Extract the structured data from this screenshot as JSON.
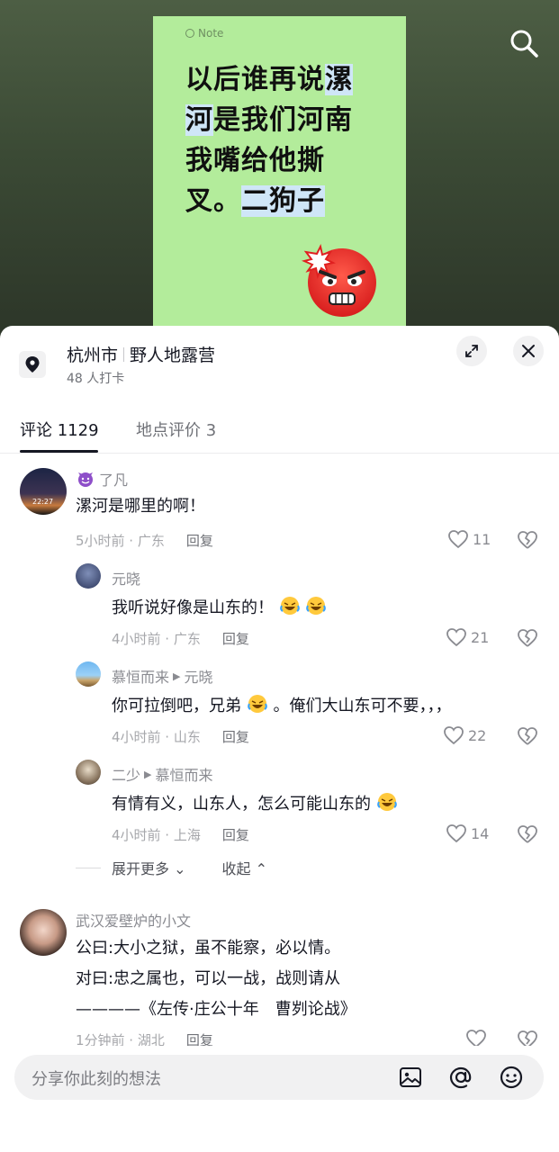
{
  "video": {
    "note_tag": "Note",
    "note_lines": [
      "以后谁再说",
      "漯",
      "河",
      "是我们河南",
      "我嘴给他撕",
      "叉。",
      "二狗子"
    ]
  },
  "location": {
    "city": "杭州市",
    "place": "野人地露营",
    "checkins": "48 人打卡"
  },
  "tabs": {
    "comments_label": "评论 1129",
    "reviews_label": "地点评价 3"
  },
  "comments": [
    {
      "user": "了凡",
      "text": "漯河是哪里的啊！",
      "time": "5小时前 · 广东",
      "reply": "回复",
      "likes": "11",
      "avatar_text": "22:27"
    },
    {
      "user": "元晓",
      "text": "我听说好像是山东的！",
      "time": "4小时前 · 广东",
      "reply": "回复",
      "likes": "21"
    },
    {
      "user": "慕恒而来",
      "reply_to": "元晓",
      "text_a": "你可拉倒吧，兄弟",
      "text_b": "。俺们大山东可不要，，，",
      "time": "4小时前 · 山东",
      "reply": "回复",
      "likes": "22"
    },
    {
      "user": "二少",
      "reply_to": "慕恒而来",
      "text": "有情有义，山东人，怎么可能山东的",
      "time": "4小时前 · 上海",
      "reply": "回复",
      "likes": "14"
    },
    {
      "user": "武汉爱壁炉的小文",
      "line1": "公曰:大小之狱，虽不能察，必以情。",
      "line2": "对曰:忠之属也，可以一战，战则请从",
      "line3": "————《左传·庄公十年　曹刿论战》",
      "time": "1分钟前 · 湖北",
      "reply": "回复"
    }
  ],
  "thread": {
    "expand_more": "展开更多",
    "collapse": "收起"
  },
  "input": {
    "placeholder": "分享你此刻的想法"
  },
  "colors": {
    "note_bg": "#b3ec9b",
    "highlight": "#cfe6f7",
    "text_primary": "#161823",
    "text_secondary": "#8a8b91"
  }
}
